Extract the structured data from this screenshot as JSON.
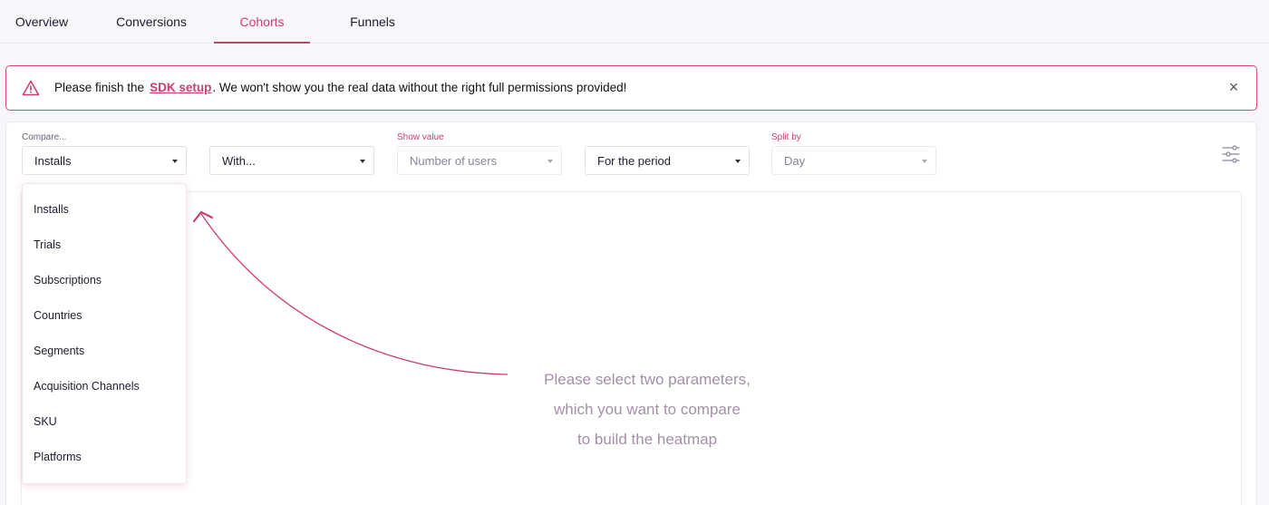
{
  "tabs": [
    {
      "label": "Overview"
    },
    {
      "label": "Conversions"
    },
    {
      "label": "Cohorts"
    },
    {
      "label": "Funnels"
    }
  ],
  "alert": {
    "prefix": "Please finish the",
    "link": "SDK setup",
    "suffix": ". We won't show you the real data without the right full permissions provided!",
    "close": "×"
  },
  "filters": {
    "compare_label": "Compare...",
    "compare_value": "Installs",
    "with_value": "With...",
    "show_value_label": "Show value",
    "show_value_value": "Number of users",
    "period_value": "For the period",
    "split_label": "Split by",
    "split_value": "Day"
  },
  "menu": {
    "items": [
      "Installs",
      "Trials",
      "Subscriptions",
      "Countries",
      "Segments",
      "Acquisition Channels",
      "SKU",
      "Platforms"
    ]
  },
  "hint": {
    "line1": "Please select two parameters,",
    "line2": "which you want to compare",
    "line3": "to build the heatmap"
  },
  "colors": {
    "accent": "#c9406b",
    "hint": "#a58fa9"
  },
  "icons": [
    "warning-icon",
    "close-icon",
    "filter-settings-icon",
    "chevron-down-icon",
    "curved-arrow-icon"
  ]
}
